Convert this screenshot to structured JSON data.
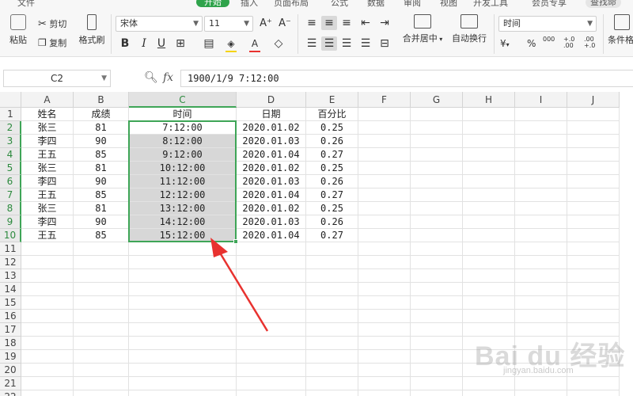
{
  "menu": {
    "tabs": [
      {
        "label": "文件"
      },
      {
        "label": "开始"
      },
      {
        "label": "插入"
      },
      {
        "label": "页面布局"
      },
      {
        "label": "公式"
      },
      {
        "label": "数据"
      },
      {
        "label": "审阅"
      },
      {
        "label": "视图"
      },
      {
        "label": "开发工具"
      },
      {
        "label": "会员专享"
      }
    ],
    "search_label": "查找命"
  },
  "ribbon": {
    "paste": "粘贴",
    "cut": "剪切",
    "copy": "复制",
    "format_painter": "格式刷",
    "font_name": "宋体",
    "font_size": "11",
    "merge_center": "合并居中",
    "wrap_text": "自动换行",
    "number_format": "时间",
    "conditional_format": "条件格",
    "percent_symbol": "%",
    "comma_symbol": "000",
    "inc_decimal": "+.0 .00",
    "dec_decimal": ".00 +.0",
    "currency_symbol": "¥"
  },
  "formula_bar": {
    "name_box": "C2",
    "fx_label": "fx",
    "formula": "1900/1/9 7:12:00"
  },
  "sheet": {
    "columns": [
      "A",
      "B",
      "C",
      "D",
      "E",
      "F",
      "G",
      "H",
      "I",
      "J"
    ],
    "row_numbers": [
      "1",
      "2",
      "3",
      "4",
      "5",
      "6",
      "7",
      "8",
      "9",
      "10",
      "11",
      "12",
      "13",
      "14",
      "15",
      "16",
      "17",
      "18",
      "19",
      "20",
      "21",
      "22"
    ],
    "rows": [
      [
        "姓名",
        "成绩",
        "时间",
        "日期",
        "百分比"
      ],
      [
        "张三",
        "81",
        "7:12:00",
        "2020.01.02",
        "0.25"
      ],
      [
        "李四",
        "90",
        "8:12:00",
        "2020.01.03",
        "0.26"
      ],
      [
        "王五",
        "85",
        "9:12:00",
        "2020.01.04",
        "0.27"
      ],
      [
        "张三",
        "81",
        "10:12:00",
        "2020.01.02",
        "0.25"
      ],
      [
        "李四",
        "90",
        "11:12:00",
        "2020.01.03",
        "0.26"
      ],
      [
        "王五",
        "85",
        "12:12:00",
        "2020.01.04",
        "0.27"
      ],
      [
        "张三",
        "81",
        "13:12:00",
        "2020.01.02",
        "0.25"
      ],
      [
        "李四",
        "90",
        "14:12:00",
        "2020.01.03",
        "0.26"
      ],
      [
        "王五",
        "85",
        "15:12:00",
        "2020.01.04",
        "0.27"
      ]
    ],
    "selected_column": "C",
    "selection_range": "C2:C10"
  },
  "watermark": {
    "logo": "Bai du 经验",
    "url": "jingyan.baidu.com"
  },
  "colors": {
    "selection_border": "#3ea557",
    "selection_fill": "#d7d7d7",
    "arrow": "#e8322f"
  }
}
